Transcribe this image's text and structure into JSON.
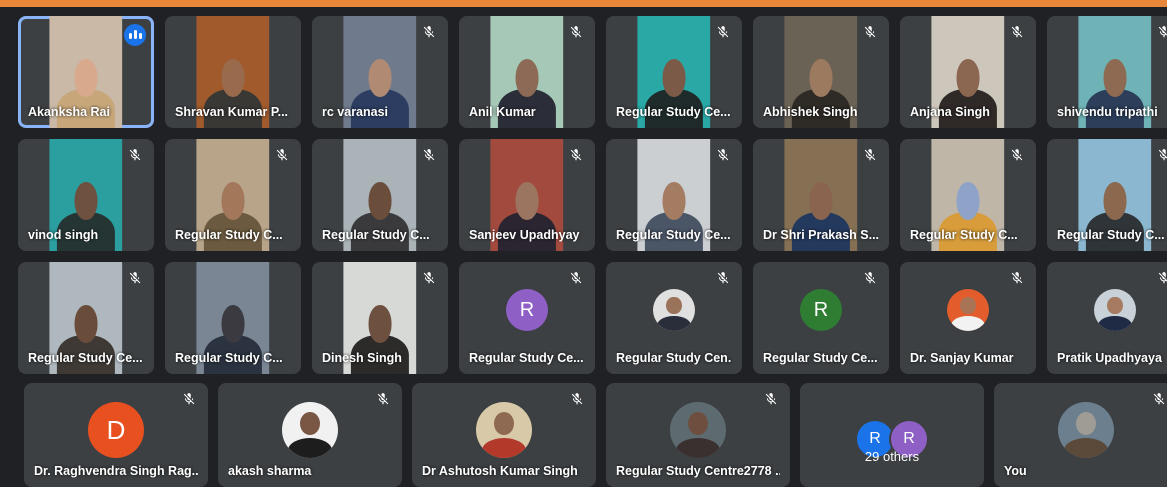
{
  "participants": [
    {
      "name": "Akanksha Rai",
      "muted": false,
      "speaking": true,
      "type": "video",
      "colors": {
        "bg": "#c9b9a6",
        "body": "#c7a77a",
        "head": "#d8a98c"
      }
    },
    {
      "name": "Shravan Kumar P...",
      "muted": false,
      "type": "video",
      "colors": {
        "bg": "#a05a2c",
        "body": "#3a3835",
        "head": "#9a6a4d"
      }
    },
    {
      "name": "rc varanasi",
      "muted": true,
      "type": "video",
      "colors": {
        "bg": "#6f7a8c",
        "body": "#2c3d61",
        "head": "#b08a72"
      }
    },
    {
      "name": "Anil Kumar",
      "muted": true,
      "type": "video",
      "colors": {
        "bg": "#a6c8b7",
        "body": "#2b2e38",
        "head": "#8d6a55"
      }
    },
    {
      "name": "Regular Study Ce...",
      "muted": true,
      "type": "video",
      "colors": {
        "bg": "#2aa8a6",
        "body": "#1e2b2a",
        "head": "#7b5a48"
      }
    },
    {
      "name": "Abhishek Singh",
      "muted": true,
      "type": "video",
      "colors": {
        "bg": "#6a6254",
        "body": "#2e2a26",
        "head": "#9c7a60"
      }
    },
    {
      "name": "Anjana Singh",
      "muted": true,
      "type": "video",
      "colors": {
        "bg": "#cdc6bb",
        "body": "#2f2927",
        "head": "#8b6650"
      }
    },
    {
      "name": "shivendu tripathi",
      "muted": true,
      "type": "video",
      "colors": {
        "bg": "#6fb3b6",
        "body": "#2c3e5a",
        "head": "#8e6a53"
      }
    },
    {
      "name": "vinod singh",
      "muted": true,
      "type": "video",
      "colors": {
        "bg": "#2b9fa0",
        "body": "#253534",
        "head": "#6f5140"
      }
    },
    {
      "name": "Regular Study C...",
      "muted": true,
      "type": "video",
      "colors": {
        "bg": "#b8a489",
        "body": "#6b5a3f",
        "head": "#a2775a"
      }
    },
    {
      "name": "Regular Study C...",
      "muted": true,
      "type": "video",
      "colors": {
        "bg": "#a9b3b8",
        "body": "#3a3a3d",
        "head": "#6b4d3c"
      }
    },
    {
      "name": "Sanjeev Upadhyay",
      "muted": true,
      "type": "video",
      "colors": {
        "bg": "#a34a3e",
        "body": "#2a2530",
        "head": "#9b7560"
      }
    },
    {
      "name": "Regular Study Ce...",
      "muted": true,
      "type": "video",
      "colors": {
        "bg": "#cbcfd2",
        "body": "#4a5566",
        "head": "#a37c62"
      }
    },
    {
      "name": "Dr Shri Prakash S...",
      "muted": true,
      "type": "video",
      "colors": {
        "bg": "#857053",
        "body": "#24395e",
        "head": "#8a644e"
      }
    },
    {
      "name": "Regular Study C...",
      "muted": true,
      "type": "video",
      "colors": {
        "bg": "#c0b6a8",
        "body": "#d89d3a",
        "head": "#8fa3c9"
      }
    },
    {
      "name": "Regular Study C...",
      "muted": true,
      "type": "video",
      "colors": {
        "bg": "#8bb8d0",
        "body": "#2f3438",
        "head": "#8c684f"
      }
    },
    {
      "name": "Regular Study Ce...",
      "muted": true,
      "type": "video",
      "colors": {
        "bg": "#aeb8be",
        "body": "#3e3935",
        "head": "#6a4c3b"
      }
    },
    {
      "name": "Regular Study C...",
      "muted": false,
      "type": "video",
      "colors": {
        "bg": "#7a8693",
        "body": "#2b3340",
        "head": "#3a3a40"
      }
    },
    {
      "name": "Dinesh Singh",
      "muted": true,
      "type": "video",
      "colors": {
        "bg": "#d7d9d6",
        "body": "#2d2b2a",
        "head": "#6d503f"
      }
    },
    {
      "name": "Regular Study Ce...",
      "muted": true,
      "type": "letter",
      "letter": "R",
      "avatar_color": "#8e5fc5"
    },
    {
      "name": "Regular Study Cen...",
      "muted": true,
      "type": "photo",
      "colors": {
        "bg": "#e0e0e0",
        "body": "#2a2d3a",
        "head": "#9b735a"
      }
    },
    {
      "name": "Regular Study Ce...",
      "muted": true,
      "type": "letter",
      "letter": "R",
      "avatar_color": "#2e7d32"
    },
    {
      "name": "Dr. Sanjay Kumar",
      "muted": true,
      "type": "photo",
      "colors": {
        "bg": "#e25d2b",
        "body": "#f2f2f2",
        "head": "#a87455"
      }
    },
    {
      "name": "Pratik Upadhyaya",
      "muted": true,
      "type": "photo",
      "colors": {
        "bg": "#c9d2d8",
        "body": "#1f2a44",
        "head": "#a67b61"
      }
    },
    {
      "name": "Dr. Raghvendra Singh Rag...",
      "muted": true,
      "type": "letter",
      "letter": "D",
      "avatar_color": "#e8501f",
      "big": true
    },
    {
      "name": "akash sharma",
      "muted": true,
      "type": "photo",
      "big": true,
      "colors": {
        "bg": "#f1f1f1",
        "body": "#1d1d1d",
        "head": "#7a5644"
      }
    },
    {
      "name": "Dr Ashutosh Kumar Singh",
      "muted": true,
      "type": "photo",
      "big": true,
      "colors": {
        "bg": "#d8c9a8",
        "body": "#b33a2b",
        "head": "#8f6a52"
      }
    },
    {
      "name": "Regular Study Centre2778 ...",
      "muted": true,
      "type": "photo",
      "big": true,
      "colors": {
        "bg": "#5d6b70",
        "body": "#3b3030",
        "head": "#6e4f3f"
      }
    },
    {
      "name": "29 others",
      "type": "others",
      "avatars": [
        {
          "letter": "R",
          "color": "#1a73e8"
        },
        {
          "letter": "R",
          "color": "#8e5fc5"
        }
      ]
    },
    {
      "name": "You",
      "muted": true,
      "type": "photo",
      "big": true,
      "colors": {
        "bg": "#6c7f8e",
        "body": "#5b4a3a",
        "head": "#9e9c95"
      }
    }
  ]
}
